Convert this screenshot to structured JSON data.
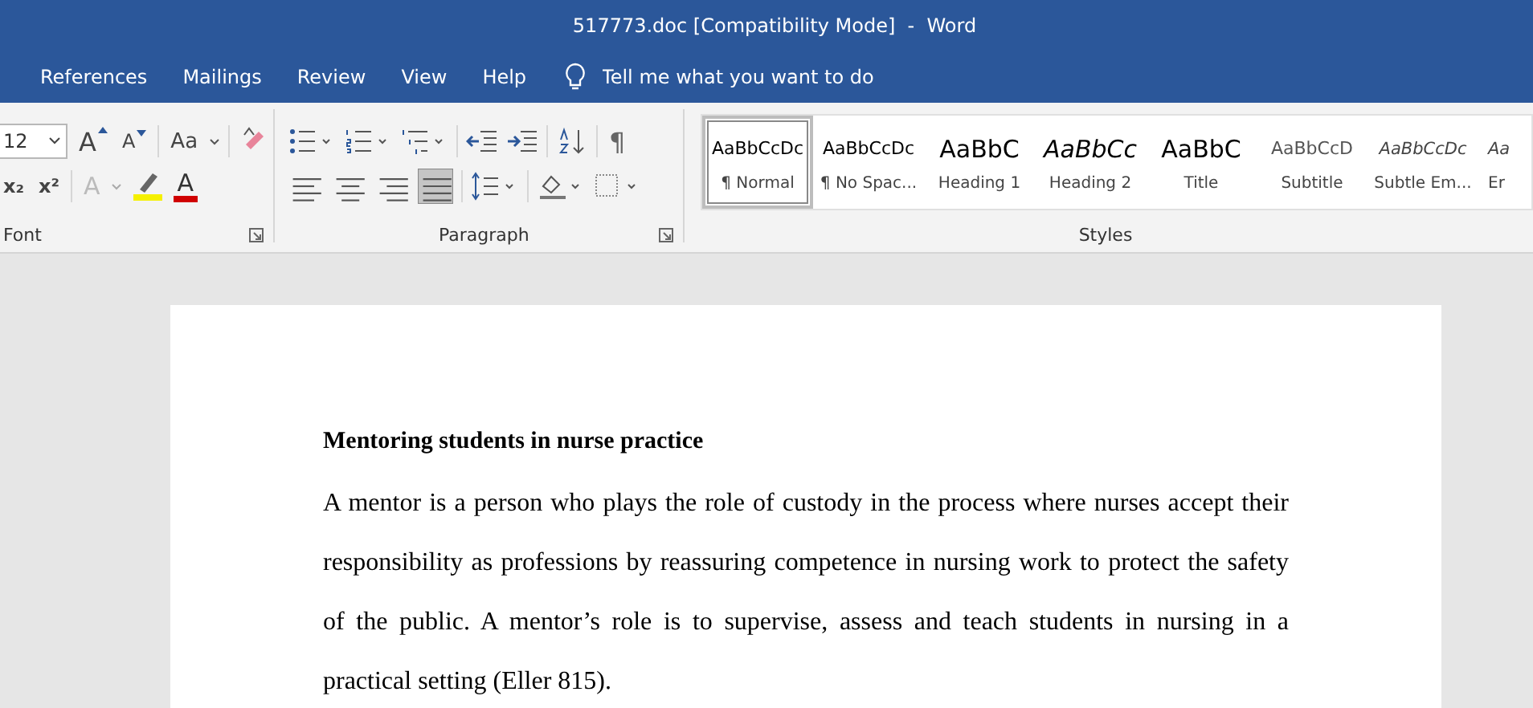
{
  "window": {
    "title": "517773.doc [Compatibility Mode]  -  Word"
  },
  "tabs": [
    {
      "label": "References",
      "selected": false
    },
    {
      "label": "Mailings",
      "selected": false
    },
    {
      "label": "Review",
      "selected": false
    },
    {
      "label": "View",
      "selected": false
    },
    {
      "label": "Help",
      "selected": false
    }
  ],
  "tell_me": {
    "placeholder": "Tell me what you want to do"
  },
  "font_group": {
    "label": "Font",
    "size": "12",
    "grow": "A",
    "shrink": "A",
    "change_case": "Aa",
    "subscript": "x₂",
    "superscript": "x²",
    "text_effects": "A",
    "font_color": "A"
  },
  "paragraph_group": {
    "label": "Paragraph",
    "show_marks": "¶",
    "alignment": [
      {
        "kind": "left",
        "selected": false
      },
      {
        "kind": "center",
        "selected": false
      },
      {
        "kind": "right",
        "selected": false
      },
      {
        "kind": "justify",
        "selected": true
      }
    ]
  },
  "styles_group": {
    "label": "Styles",
    "items": [
      {
        "preview": "AaBbCcDc",
        "label": "¶ Normal",
        "kind": "normal",
        "selected": true
      },
      {
        "preview": "AaBbCcDc",
        "label": "¶ No Spac...",
        "kind": "normal",
        "selected": false
      },
      {
        "preview": "AaBbC",
        "label": "Heading 1",
        "kind": "large",
        "selected": false
      },
      {
        "preview": "AaBbCc",
        "label": "Heading 2",
        "kind": "large-italic",
        "selected": false
      },
      {
        "preview": "AaBbC",
        "label": "Title",
        "kind": "large",
        "selected": false
      },
      {
        "preview": "AaBbCcD",
        "label": "Subtitle",
        "kind": "light",
        "selected": false
      },
      {
        "preview": "AaBbCcDc",
        "label": "Subtle Em...",
        "kind": "italic",
        "selected": false
      },
      {
        "preview": "Aa",
        "label": "Er",
        "kind": "italic",
        "selected": false
      }
    ]
  },
  "document": {
    "heading": "Mentoring students in nurse practice",
    "paragraphs": [
      "A mentor is a person who plays the role of custody in the process where nurses accept their responsibility as professions by reassuring competence in nursing work to protect the safety of the public. A mentor’s role is to supervise, assess and teach students in nursing in a practical setting (Eller 815)."
    ]
  }
}
